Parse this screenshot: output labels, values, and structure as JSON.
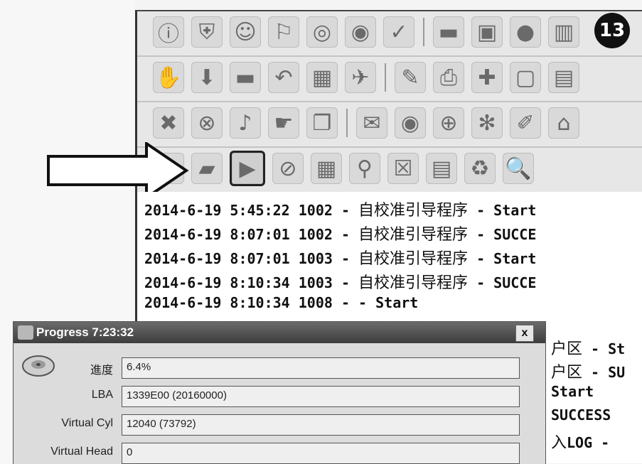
{
  "badge": {
    "number": "13"
  },
  "toolbar_rows": [
    {
      "icons": [
        "info-icon",
        "shield-check-icon",
        "users-icon",
        "person-run-icon",
        "disc-icon",
        "globe-refresh-icon",
        "checkmark-icon",
        "|",
        "memory-chip-icon",
        "monitor-settings-icon",
        "sphere-icon",
        "trash-icon"
      ]
    },
    {
      "icons": [
        "hand-card-icon",
        "download-icon",
        "panel-icon",
        "back-arrow-icon",
        "network-icon",
        "plane-icon",
        "|",
        "clipboard-edit-icon",
        "printer-icon",
        "puzzle-icon",
        "clipboard-icon",
        "grid-icon"
      ]
    },
    {
      "icons": [
        "shield-x-icon",
        "x-circle-icon",
        "bell-icon",
        "pointer-hand-icon",
        "copy-pages-icon",
        "|",
        "chat-icon",
        "eye-disc-icon",
        "earth-icon",
        "gears-icon",
        "wrench-icon",
        "computer-network-icon"
      ]
    },
    {
      "icons": [
        "gear-refresh-icon",
        "car-icon",
        "play-icon",
        "no-sign-icon",
        "calculator-icon",
        "person-search-icon",
        "close-window-icon",
        "document-icon",
        "recycle-icon",
        "magnifier-icon"
      ]
    }
  ],
  "icon_glyphs": {
    "info-icon": "ⓘ",
    "shield-check-icon": "⛨",
    "users-icon": "☺",
    "person-run-icon": "⚐",
    "disc-icon": "◎",
    "globe-refresh-icon": "◉",
    "checkmark-icon": "✓",
    "memory-chip-icon": "▬",
    "monitor-settings-icon": "▣",
    "sphere-icon": "●",
    "trash-icon": "▥",
    "hand-card-icon": "✋",
    "download-icon": "⬇",
    "panel-icon": "▬",
    "back-arrow-icon": "↶",
    "network-icon": "▦",
    "plane-icon": "✈",
    "clipboard-edit-icon": "✎",
    "printer-icon": "⎙",
    "puzzle-icon": "✚",
    "clipboard-icon": "▢",
    "grid-icon": "▤",
    "shield-x-icon": "✖",
    "x-circle-icon": "⊗",
    "bell-icon": "♪",
    "pointer-hand-icon": "☛",
    "copy-pages-icon": "❐",
    "chat-icon": "✉",
    "eye-disc-icon": "◉",
    "earth-icon": "⊕",
    "gears-icon": "✻",
    "wrench-icon": "✐",
    "computer-network-icon": "⌂",
    "gear-refresh-icon": "✲",
    "car-icon": "▰",
    "play-icon": "▶",
    "no-sign-icon": "⊘",
    "calculator-icon": "▦",
    "person-search-icon": "⚲",
    "close-window-icon": "☒",
    "document-icon": "▤",
    "recycle-icon": "♻",
    "magnifier-icon": "🔍"
  },
  "log_lines": [
    {
      "prefix": "2014-6-19 5:45:22 1002 - ",
      "cjk": "自校准引导程序",
      "suffix": " - Start"
    },
    {
      "prefix": "2014-6-19 8:07:01 1002 - ",
      "cjk": "自校准引导程序",
      "suffix": " - SUCCE"
    },
    {
      "prefix": "2014-6-19 8:07:01 1003 - ",
      "cjk": "自校准引导程序",
      "suffix": " - Start"
    },
    {
      "prefix": "2014-6-19 8:10:34 1003 - ",
      "cjk": "自校准引导程序",
      "suffix": " - SUCCE"
    },
    {
      "prefix": "2014-6-19 8:10:34 1008 -  - Start",
      "cjk": "",
      "suffix": ""
    }
  ],
  "log_tail_lines": [
    {
      "prefix": "",
      "cjk": "户区",
      "suffix": " - St"
    },
    {
      "prefix": "",
      "cjk": "户区",
      "suffix": " - SU"
    },
    {
      "prefix": "Start",
      "cjk": "",
      "suffix": ""
    },
    {
      "prefix": "SUCCESS",
      "cjk": "",
      "suffix": ""
    },
    {
      "prefix": "",
      "cjk": "入",
      "suffix": "LOG -"
    }
  ],
  "progress_dialog": {
    "title": "Progress  7:23:32",
    "close_label": "x",
    "fields": [
      {
        "label": "進度",
        "value": "6.4%"
      },
      {
        "label": "LBA",
        "value": "1339E00  (20160000)"
      },
      {
        "label": "Virtual Cyl",
        "value": "12040  (73792)"
      },
      {
        "label": "Virtual Head",
        "value": "0"
      }
    ]
  }
}
